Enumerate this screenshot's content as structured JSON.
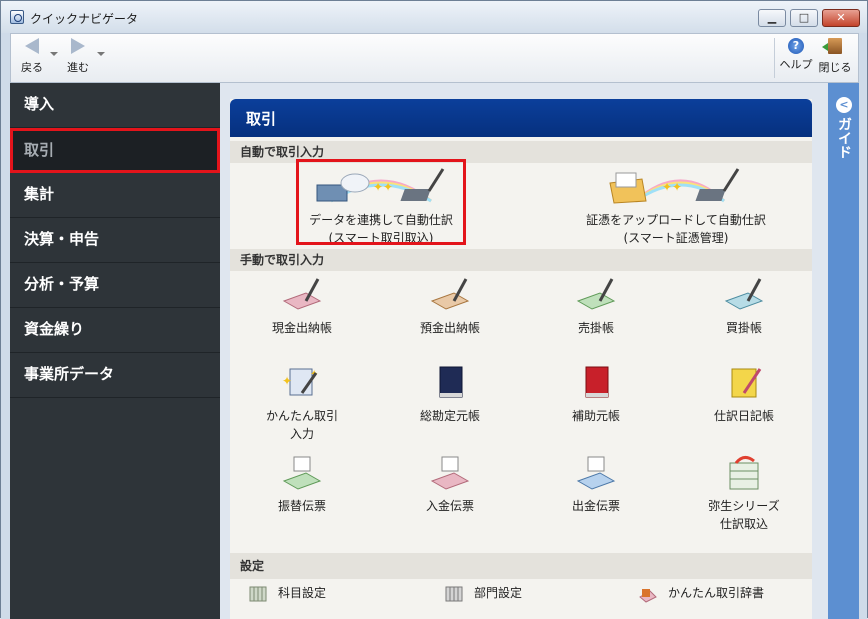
{
  "window": {
    "title": "クイックナビゲータ"
  },
  "toolbar": {
    "back": "戻る",
    "forward": "進む",
    "help": "ヘルプ",
    "close": "閉じる"
  },
  "sidebar": {
    "items": [
      {
        "label": "導入"
      },
      {
        "label": "取引"
      },
      {
        "label": "集計"
      },
      {
        "label": "決算・申告"
      },
      {
        "label": "分析・予算"
      },
      {
        "label": "資金繰り"
      },
      {
        "label": "事業所データ"
      }
    ]
  },
  "panel": {
    "title": "取引",
    "auto_section": "自動で取引入力",
    "auto_items": [
      {
        "line1": "データを連携して自動仕訳",
        "line2": "(スマート取引取込)"
      },
      {
        "line1": "証憑をアップロードして自動仕訳",
        "line2": "(スマート証憑管理)"
      }
    ],
    "manual_section": "手動で取引入力",
    "manual_items": [
      {
        "line1": "現金出納帳",
        "line2": ""
      },
      {
        "line1": "預金出納帳",
        "line2": ""
      },
      {
        "line1": "売掛帳",
        "line2": ""
      },
      {
        "line1": "買掛帳",
        "line2": ""
      },
      {
        "line1": "かんたん取引",
        "line2": "入力"
      },
      {
        "line1": "総勘定元帳",
        "line2": ""
      },
      {
        "line1": "補助元帳",
        "line2": ""
      },
      {
        "line1": "仕訳日記帳",
        "line2": ""
      },
      {
        "line1": "振替伝票",
        "line2": ""
      },
      {
        "line1": "入金伝票",
        "line2": ""
      },
      {
        "line1": "出金伝票",
        "line2": ""
      },
      {
        "line1": "弥生シリーズ",
        "line2": "仕訳取込"
      }
    ],
    "settings_section": "設定",
    "settings_items": [
      {
        "label": "科目設定"
      },
      {
        "label": "部門設定"
      },
      {
        "label": "かんたん取引辞書"
      }
    ]
  },
  "guide": {
    "label": "ガイド"
  },
  "colors": {
    "accent_blue": "#0b3f9b",
    "highlight_red": "#e3141b",
    "sidebar_bg": "#2e3439",
    "guide_blue": "#5c8fd1"
  }
}
